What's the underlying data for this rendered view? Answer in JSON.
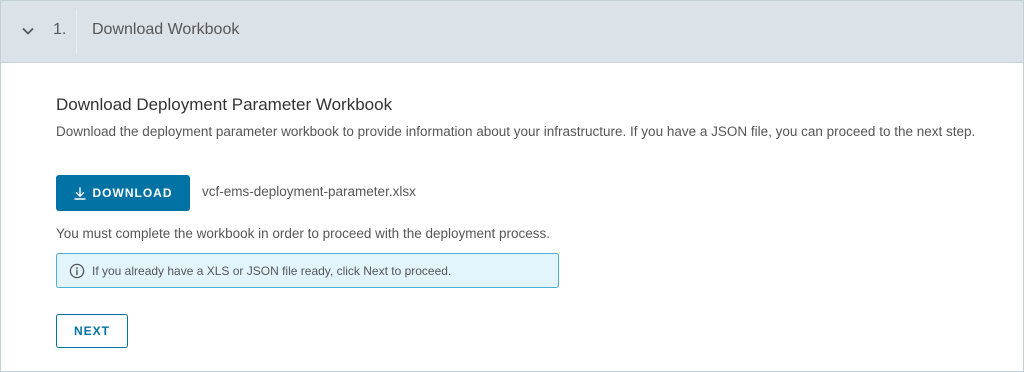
{
  "step": {
    "number": "1.",
    "title": "Download Workbook",
    "expanded": true,
    "toggle_icon": "chevron-down-icon"
  },
  "section": {
    "title": "Download Deployment Parameter Workbook",
    "description": "Download the deployment parameter workbook to provide information about your infrastructure. If you have a JSON file, you can proceed to the next step."
  },
  "download": {
    "icon": "download-icon",
    "label": "DOWNLOAD",
    "file_name": "vcf-ems-deployment-parameter.xlsx"
  },
  "notice": "You must complete the workbook in order to proceed with the deployment process.",
  "alert": {
    "icon": "info-icon",
    "text": "If you already have a XLS or JSON file ready, click Next to proceed."
  },
  "next_button": {
    "label": "NEXT"
  },
  "colors": {
    "header_bg": "#dbe3e9",
    "primary": "#0072a3",
    "alert_bg": "#e3f5fc",
    "alert_border": "#49afd9",
    "text": "#565656"
  }
}
